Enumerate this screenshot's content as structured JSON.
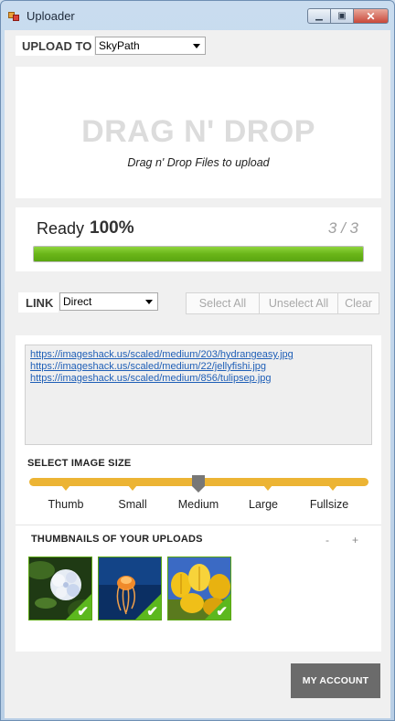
{
  "window": {
    "title": "Uploader"
  },
  "upload_to": {
    "label": "UPLOAD TO",
    "value": "SkyPath"
  },
  "drop_zone": {
    "title": "DRAG N' DROP",
    "subtitle": "Drag n' Drop Files to upload"
  },
  "progress": {
    "status": "Ready",
    "percent_label": "100%",
    "fraction": 1.0,
    "count": "3 / 3"
  },
  "link": {
    "label": "LINK",
    "value": "Direct"
  },
  "actions": {
    "select_all": "Select All",
    "unselect_all": "Unselect All",
    "clear": "Clear"
  },
  "links": [
    "https://imageshack.us/scaled/medium/203/hydrangeasy.jpg",
    "https://imageshack.us/scaled/medium/22/jellyfishi.jpg",
    "https://imageshack.us/scaled/medium/856/tulipsep.jpg"
  ],
  "image_size": {
    "heading": "SELECT IMAGE SIZE",
    "options": [
      "Thumb",
      "Small",
      "Medium",
      "Large",
      "Fullsize"
    ],
    "selected": "Medium"
  },
  "thumbnails": {
    "heading": "THUMBNAILS OF YOUR UPLOADS",
    "zoom_out": "-",
    "zoom_in": "+",
    "items": [
      "hydrangea",
      "jellyfish",
      "tulips"
    ]
  },
  "account": {
    "label": "MY ACCOUNT"
  },
  "colors": {
    "progress": "#6ab519",
    "slider": "#ecb434",
    "check": "#5cb81e",
    "account": "#6b6b6b"
  }
}
